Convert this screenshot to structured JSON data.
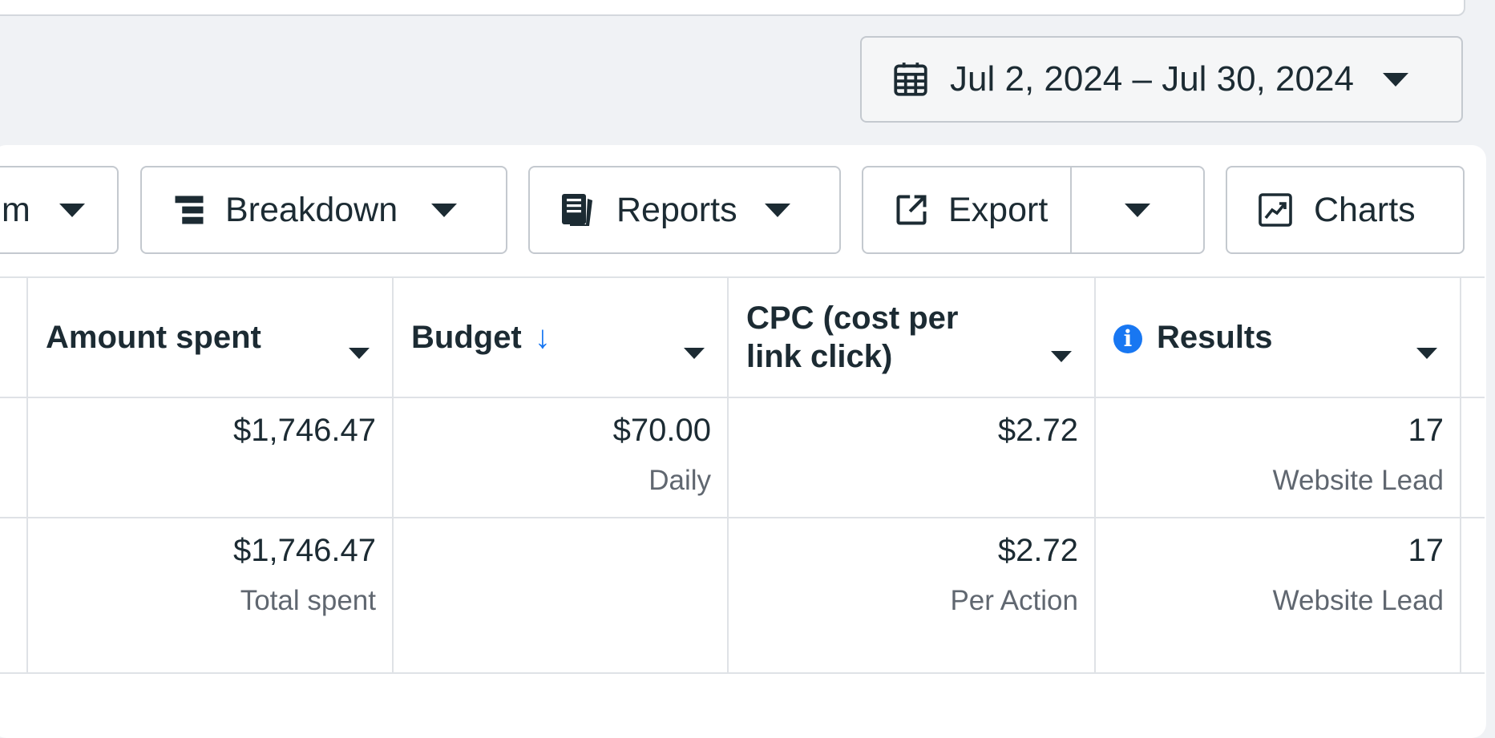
{
  "date_range": {
    "label": "Jul 2, 2024 – Jul 30, 2024",
    "icon": "calendar-icon"
  },
  "toolbar": {
    "partial_label": "m",
    "breakdown_label": "Breakdown",
    "reports_label": "Reports",
    "export_label": "Export",
    "charts_label": "Charts"
  },
  "table": {
    "headers": {
      "amount_spent": "Amount spent",
      "budget": "Budget",
      "budget_sort": "↓",
      "cpc": "CPC (cost per link click)",
      "results": "Results"
    },
    "rows": [
      {
        "amount_spent": "$1,746.47",
        "amount_spent_sub": "",
        "budget": "$70.00",
        "budget_sub": "Daily",
        "cpc": "$2.72",
        "cpc_sub": "",
        "results": "17",
        "results_sub": "Website Lead"
      },
      {
        "amount_spent": "$1,746.47",
        "amount_spent_sub": "Total spent",
        "budget": "",
        "budget_sub": "",
        "cpc": "$2.72",
        "cpc_sub": "Per Action",
        "results": "17",
        "results_sub": "Website Lead"
      }
    ]
  },
  "colors": {
    "accent": "#1877f2",
    "text": "#1c2b33",
    "muted": "#606770",
    "border": "#c4c9cf",
    "background": "#f0f2f5"
  }
}
